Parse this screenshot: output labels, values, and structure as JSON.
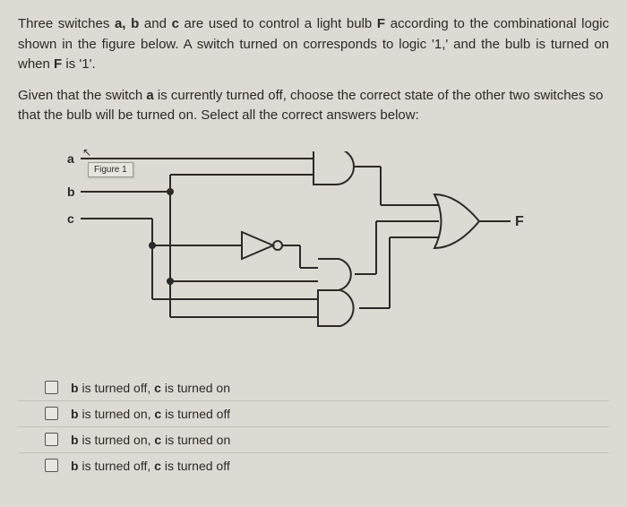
{
  "question": {
    "paragraph1_parts": {
      "p1": "Three switches ",
      "p2": "a, b",
      "p3": " and ",
      "p4": "c",
      "p5": " are used to control a light bulb ",
      "p6": "F",
      "p7": " according to the combinational logic shown in the figure below. A switch turned on corresponds to logic '1,' and the bulb is turned on when ",
      "p8": "F",
      "p9": " is '1'."
    },
    "paragraph2_parts": {
      "p1": "Given that the switch ",
      "p2": "a",
      "p3": " is currently turned off, choose the correct state of the other two switches so that the bulb will be turned on. Select all the correct answers below:"
    }
  },
  "figure": {
    "label_a": "a",
    "label_b": "b",
    "label_c": "c",
    "label_f": "F",
    "figure_tag": "Figure 1"
  },
  "options": [
    {
      "b": "b",
      "b_state": " is turned off, ",
      "c": "c",
      "c_state": " is turned on"
    },
    {
      "b": "b",
      "b_state": " is turned on, ",
      "c": "c",
      "c_state": " is turned off"
    },
    {
      "b": "b",
      "b_state": " is turned on, ",
      "c": "c",
      "c_state": " is turned on"
    },
    {
      "b": "b",
      "b_state": " is turned off, ",
      "c": "c",
      "c_state": " is turned off"
    }
  ]
}
